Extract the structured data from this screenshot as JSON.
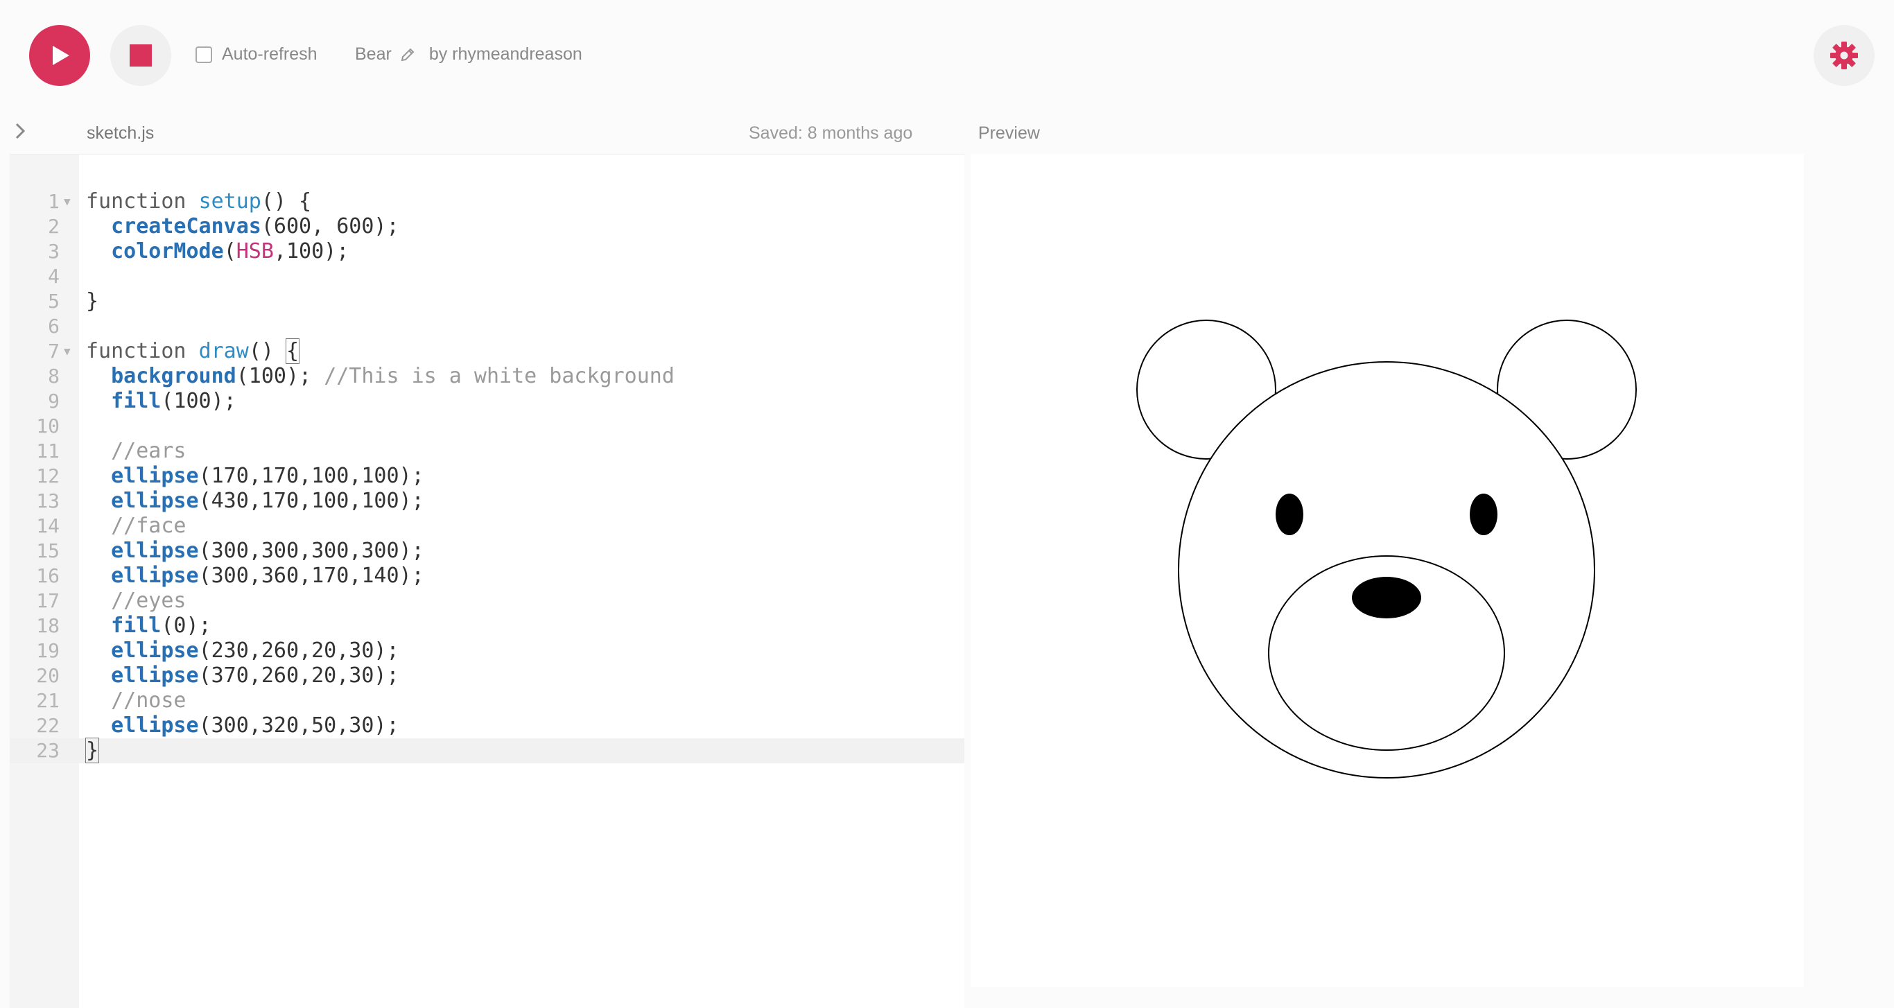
{
  "toolbar": {
    "play_icon": "play-icon",
    "stop_icon": "stop-icon",
    "autorefresh_label": "Auto-refresh",
    "autorefresh_checked": false,
    "sketch_name": "Bear",
    "edit_icon": "pencil-icon",
    "author": "by rhymeandreason",
    "settings_icon": "gear-icon",
    "accent_color": "#d9325b"
  },
  "editor": {
    "file_name": "sketch.js",
    "saved_status": "Saved: 8 months ago",
    "active_line": 23,
    "lines": [
      {
        "n": "1",
        "fold": true,
        "tokens": [
          {
            "t": "function ",
            "c": "kw"
          },
          {
            "t": "setup",
            "c": "def"
          },
          {
            "t": "() {",
            "c": ""
          }
        ]
      },
      {
        "n": "2",
        "tokens": [
          {
            "t": "  ",
            "c": ""
          },
          {
            "t": "createCanvas",
            "c": "fn"
          },
          {
            "t": "(600, 600);",
            "c": ""
          }
        ]
      },
      {
        "n": "3",
        "tokens": [
          {
            "t": "  ",
            "c": ""
          },
          {
            "t": "colorMode",
            "c": "fn"
          },
          {
            "t": "(",
            "c": ""
          },
          {
            "t": "HSB",
            "c": "const"
          },
          {
            "t": ",100);",
            "c": ""
          }
        ]
      },
      {
        "n": "4",
        "tokens": []
      },
      {
        "n": "5",
        "tokens": [
          {
            "t": "}",
            "c": ""
          }
        ]
      },
      {
        "n": "6",
        "tokens": []
      },
      {
        "n": "7",
        "fold": true,
        "tokens": [
          {
            "t": "function ",
            "c": "kw"
          },
          {
            "t": "draw",
            "c": "def"
          },
          {
            "t": "() ",
            "c": ""
          },
          {
            "t": "{",
            "c": "bracket"
          }
        ]
      },
      {
        "n": "8",
        "tokens": [
          {
            "t": "  ",
            "c": ""
          },
          {
            "t": "background",
            "c": "fn"
          },
          {
            "t": "(100); ",
            "c": ""
          },
          {
            "t": "//This is a white background",
            "c": "comment"
          }
        ]
      },
      {
        "n": "9",
        "tokens": [
          {
            "t": "  ",
            "c": ""
          },
          {
            "t": "fill",
            "c": "fn"
          },
          {
            "t": "(100);",
            "c": ""
          }
        ]
      },
      {
        "n": "10",
        "tokens": []
      },
      {
        "n": "11",
        "tokens": [
          {
            "t": "  ",
            "c": ""
          },
          {
            "t": "//ears",
            "c": "comment"
          }
        ]
      },
      {
        "n": "12",
        "tokens": [
          {
            "t": "  ",
            "c": ""
          },
          {
            "t": "ellipse",
            "c": "fn"
          },
          {
            "t": "(170,170,100,100);",
            "c": ""
          }
        ]
      },
      {
        "n": "13",
        "tokens": [
          {
            "t": "  ",
            "c": ""
          },
          {
            "t": "ellipse",
            "c": "fn"
          },
          {
            "t": "(430,170,100,100);",
            "c": ""
          }
        ]
      },
      {
        "n": "14",
        "tokens": [
          {
            "t": "  ",
            "c": ""
          },
          {
            "t": "//face",
            "c": "comment"
          }
        ]
      },
      {
        "n": "15",
        "tokens": [
          {
            "t": "  ",
            "c": ""
          },
          {
            "t": "ellipse",
            "c": "fn"
          },
          {
            "t": "(300,300,300,300);",
            "c": ""
          }
        ]
      },
      {
        "n": "16",
        "tokens": [
          {
            "t": "  ",
            "c": ""
          },
          {
            "t": "ellipse",
            "c": "fn"
          },
          {
            "t": "(300,360,170,140);",
            "c": ""
          }
        ]
      },
      {
        "n": "17",
        "tokens": [
          {
            "t": "  ",
            "c": ""
          },
          {
            "t": "//eyes",
            "c": "comment"
          }
        ]
      },
      {
        "n": "18",
        "tokens": [
          {
            "t": "  ",
            "c": ""
          },
          {
            "t": "fill",
            "c": "fn"
          },
          {
            "t": "(0);",
            "c": ""
          }
        ]
      },
      {
        "n": "19",
        "tokens": [
          {
            "t": "  ",
            "c": ""
          },
          {
            "t": "ellipse",
            "c": "fn"
          },
          {
            "t": "(230,260,20,30);",
            "c": ""
          }
        ]
      },
      {
        "n": "20",
        "tokens": [
          {
            "t": "  ",
            "c": ""
          },
          {
            "t": "ellipse",
            "c": "fn"
          },
          {
            "t": "(370,260,20,30);",
            "c": ""
          }
        ]
      },
      {
        "n": "21",
        "tokens": [
          {
            "t": "  ",
            "c": ""
          },
          {
            "t": "//nose",
            "c": "comment"
          }
        ]
      },
      {
        "n": "22",
        "tokens": [
          {
            "t": "  ",
            "c": ""
          },
          {
            "t": "ellipse",
            "c": "fn"
          },
          {
            "t": "(300,320,50,30);",
            "c": ""
          }
        ]
      },
      {
        "n": "23",
        "tokens": [
          {
            "t": "}",
            "c": "bracket"
          }
        ]
      }
    ]
  },
  "preview": {
    "label": "Preview",
    "shapes": [
      {
        "name": "left-ear",
        "fill": "#ffffff"
      },
      {
        "name": "right-ear",
        "fill": "#ffffff"
      },
      {
        "name": "face",
        "fill": "#ffffff"
      },
      {
        "name": "muzzle",
        "fill": "#ffffff"
      },
      {
        "name": "left-eye",
        "fill": "#000000"
      },
      {
        "name": "right-eye",
        "fill": "#000000"
      },
      {
        "name": "nose",
        "fill": "#000000"
      }
    ]
  }
}
